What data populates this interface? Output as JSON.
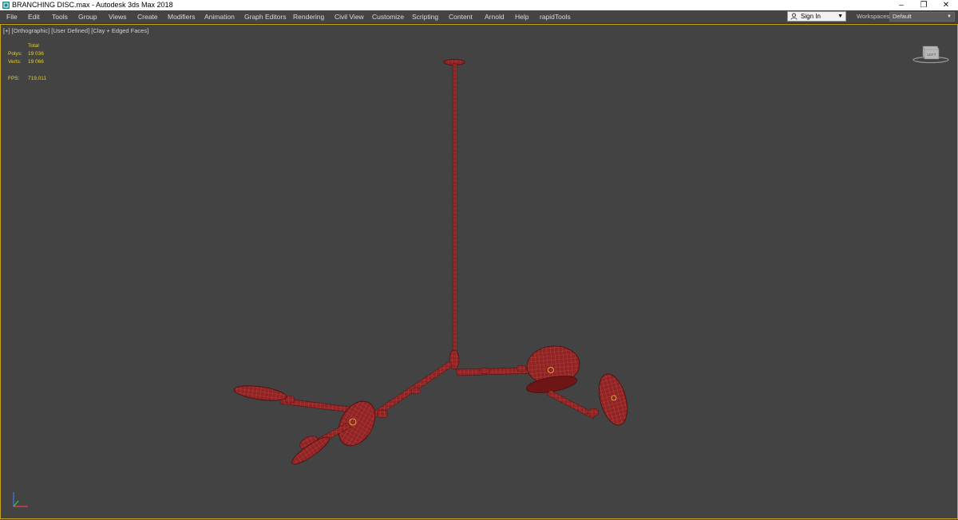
{
  "window": {
    "title": "BRANCHING DISC.max - Autodesk 3ds Max 2018",
    "minimize_icon": "minimize-icon",
    "restore_icon": "restore-icon",
    "close_icon": "close-icon"
  },
  "menu": {
    "items": [
      "File",
      "Edit",
      "Tools",
      "Group",
      "Views",
      "Create",
      "Modifiers",
      "Animation",
      "Graph Editors",
      "Rendering",
      "Civil View",
      "Customize",
      "Scripting",
      "Content",
      "Arnold",
      "Help",
      "rapidTools"
    ]
  },
  "account": {
    "sign_in": "Sign In"
  },
  "workspace": {
    "label": "Workspaces:",
    "value": "Default"
  },
  "viewport": {
    "label": "[+] [Orthographic] [User Defined] [Clay + Edged Faces]",
    "stats": {
      "total_label": "Total",
      "polys_label": "Polys:",
      "polys_value": "19 036",
      "verts_label": "Verts:",
      "verts_value": "19 066",
      "fps_label": "FPS:",
      "fps_value": "719,011"
    },
    "viewcube_label": "LEFT"
  },
  "colors": {
    "viewport_bg": "#434343",
    "active_border": "#c8a51a",
    "model_fill": "#8f2424",
    "model_wire": "#e05858",
    "stats_text": "#e3cf3c"
  }
}
